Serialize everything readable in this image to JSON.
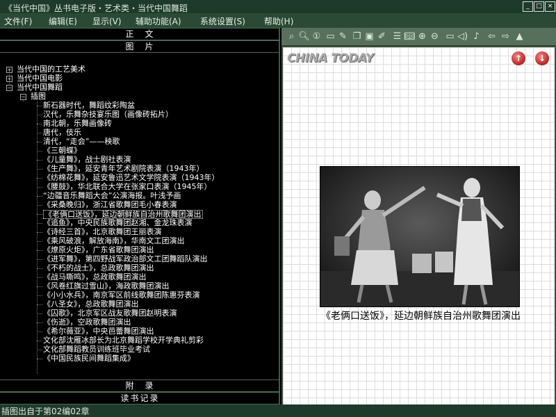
{
  "window": {
    "title": "《当代中国》丛书电子版・艺术类・当代中国舞蹈",
    "controls": [
      "_",
      "□",
      "×"
    ]
  },
  "menubar": {
    "items": [
      "文件(F)",
      "编辑(E)",
      "显示(V)",
      "辅助功能(A)",
      "系统设置(S)",
      "帮助(H)"
    ]
  },
  "left_panel": {
    "section_main": "正　文",
    "section_figures": "图　片",
    "section_appendix": "附　录",
    "section_notes": "读书记录",
    "tree": {
      "roots": [
        {
          "expander": "+",
          "label": "当代中国的工艺美术"
        },
        {
          "expander": "+",
          "label": "当代中国电影"
        },
        {
          "expander": "−",
          "label": "当代中国舞蹈"
        }
      ],
      "folder": {
        "expander": "−",
        "label": "插图"
      },
      "items": [
        "新石器时代，舞蹈纹彩陶盆",
        "汉代，乐舞杂技宴乐图（画像砖拓片）",
        "南北朝，乐舞画像砖",
        "唐代，伎乐",
        "清代，“走会”——秧歌",
        "《三朝蝶》",
        "《儿童舞》，战士剧社表演",
        "《生产舞》，延安青年艺术剧院表演（1943年）",
        "《纺棉花舞》，延安鲁迅艺术文学院表演（1943年）",
        "《腰鼓》，华北联合大学在张家口表演（1945年）",
        "“边疆音乐舞蹈大会”公演海报。叶浅予画",
        "《采桑晚归》，浙江省歌舞团毛小春表演",
        "《老俩口送饭》，延边朝鲜族自治州歌舞团演出",
        "《追鱼》，中央民族歌舞团赵湘、金龙珠表演",
        "《诗经三首》，北京歌舞团王丽表演",
        "《乘风破浪，解放海南》，华南文工团演出",
        "《燎原火炬》，广东省歌舞团演出",
        "《进军舞》，第四野战军政治部文工团舞蹈队演出",
        "《不朽的战士》，总政歌舞团演出",
        "《战马嘶鸣》，总政歌舞团演出",
        "《风卷红旗过雪山》，海政歌舞团演出",
        "《小小水兵》，南京军区前线歌舞团陈惠芬表演",
        "《八圣女》，总政歌舞团演出",
        "《囚歌》，北京军区战友歌舞团赵明表演",
        "《伤逝》，空政歌舞团演出",
        "《希尔薇亚》，中央芭蕾舞团演出",
        "文化部沈雁冰部长为北京舞蹈学校开学典礼剪彩",
        "文化部舞蹈教员训练班毕业考试",
        "《中国民族民间舞蹈集成》"
      ],
      "selected_index": 12
    }
  },
  "toolbar": {
    "icons": [
      "search-page-icon",
      "search-icon",
      "number-icon",
      "select-icon",
      "pen-icon",
      "copy-icon",
      "paste-icon",
      "edit-icon",
      "list-icon",
      "book-icon",
      "zoom-in-icon",
      "zoom-out-icon",
      "link-icon",
      "speaker-icon",
      "speaker-wave-icon",
      "back-icon",
      "forward-icon",
      "up-icon"
    ]
  },
  "viewer": {
    "logo_text": "CHINA TODAY",
    "prev_arrow": "↑",
    "next_arrow": "↓",
    "caption": "《老俩口送饭》，延边朝鲜族自治州歌舞团演出"
  },
  "statusbar": {
    "text": "插图出自于第02编02章"
  },
  "colors": {
    "titlebar": "#1e3a2a",
    "menubar": "#2a4a36",
    "toolbar": "#56705c",
    "nav_arrow": "#b22222"
  }
}
